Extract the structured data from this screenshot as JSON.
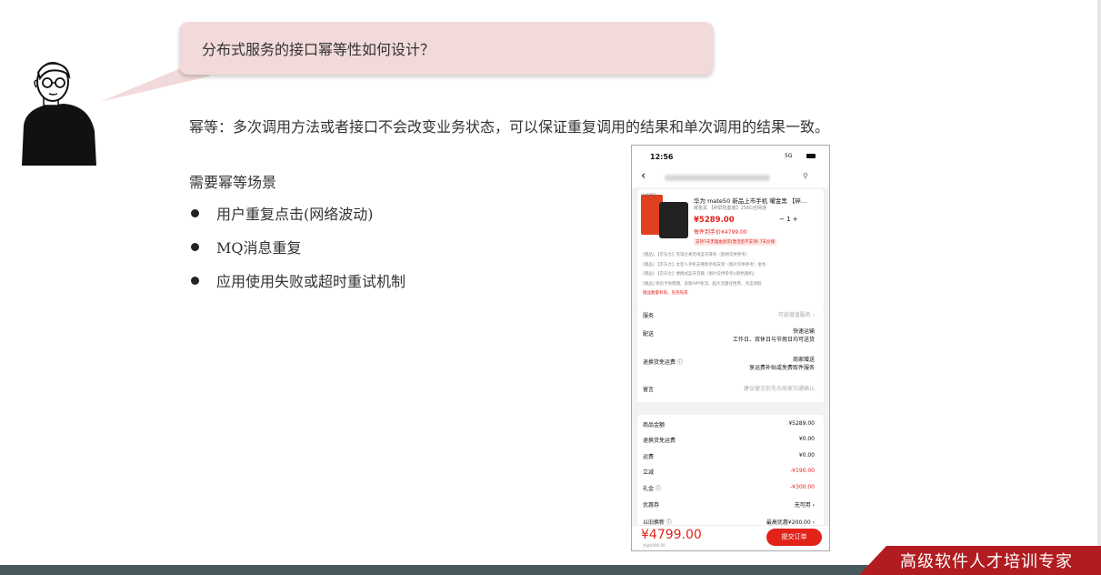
{
  "question": "分布式服务的接口幂等性如何设计？",
  "definition": "幂等：多次调用方法或者接口不会改变业务状态，可以保证重复调用的结果和单次调用的结果一致。",
  "scenarios": {
    "title": "需要幂等场景",
    "items": [
      "用户重复点击(网络波动)",
      "MQ消息重复",
      "应用使用失败或超时重试机制"
    ]
  },
  "brand": "高级软件人才培训专家",
  "phone": {
    "time": "12:56",
    "signal": "5G",
    "back": "‹",
    "product": {
      "tag": "HUAWEI",
      "title": "华为 mate50 新品上市手机 曜金黑 【碎…",
      "spec": "曜金黑 【碎屏险套装】256G全网通",
      "price": "¥5289.00",
      "qty": "− 1 +",
      "per_unit": "每件到手价¥4799.00",
      "badge": "支持7天无理由退货(激活后不支持) 7天价保",
      "gifts": [
        "[赠品] 【京东仓】充电仓真无线蓝牙耳机（图例仅供参考）",
        "[赠品] 【京东仓】太空人手机支撑款手机支架（图片仅供参考）金色",
        "[赠品] 【京东仓】便携式蓝牙音箱（图片仅供参考)(颜色随机)",
        "[赠品] 体验卡免费期、多款APP免流、超大流量任性用、点击领取"
      ],
      "gift_note": "赠品数量有限，先到先得"
    },
    "service": {
      "label": "服务",
      "value": "可选增值服务 ›"
    },
    "delivery": {
      "label": "配送",
      "value1": "快速运输",
      "value2": "工作日、双休日与节假日均可送货"
    },
    "return_fee": {
      "label": "退换货免运费 ⓘ",
      "value1": "商家赠送",
      "value2": "享运费补贴或免费取件服务"
    },
    "note": {
      "label": "留言",
      "placeholder": "建议留言前先与商家沟通确认"
    },
    "summary": [
      {
        "label": "商品金额",
        "value": "¥5289.00"
      },
      {
        "label": "退换货免运费",
        "value": "¥0.00"
      },
      {
        "label": "运费",
        "value": "¥0.00"
      },
      {
        "label": "立减",
        "value": "-¥190.00"
      },
      {
        "label": "礼金 ⓘ",
        "value": "-¥300.00"
      },
      {
        "label": "优惠券",
        "value": "无可用 ›"
      },
      {
        "label": "以旧换新 ⓘ",
        "value": "最高优惠¥200.00 ›"
      }
    ],
    "total": "¥4799.00",
    "saved": "共省¥490.00",
    "submit": "提交订单"
  }
}
